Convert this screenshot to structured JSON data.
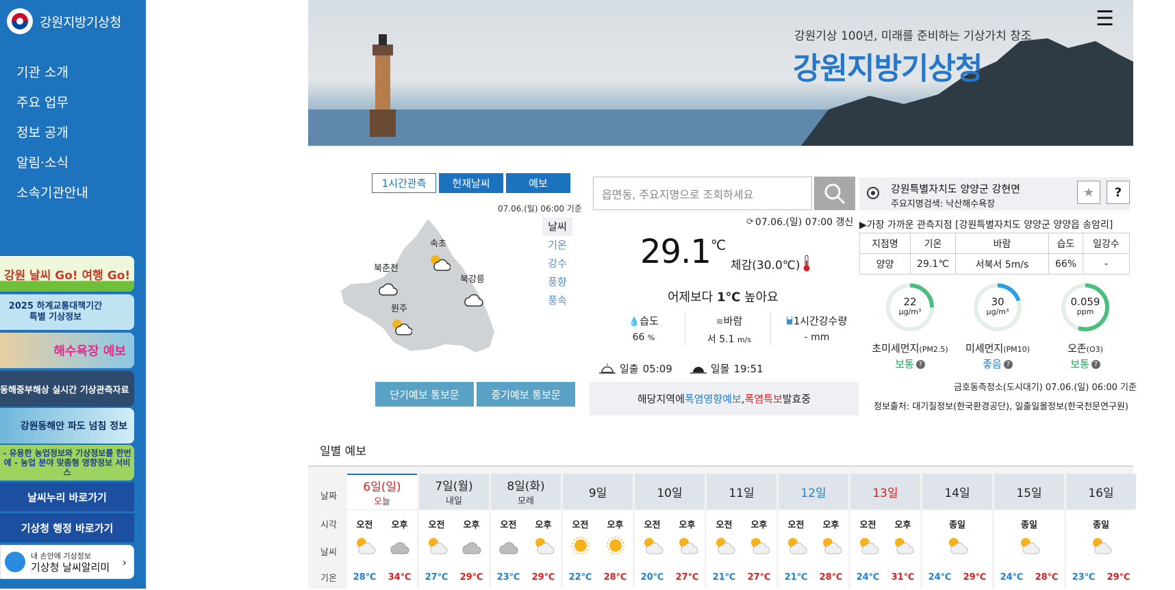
{
  "sidebar": {
    "logo_text": "강원지방기상청",
    "nav": [
      "기관 소개",
      "주요 업무",
      "정보 공개",
      "알림·소식",
      "소속기관안내"
    ],
    "banners": [
      "강원 날씨 Go! 여행 Go!",
      "2025 하계교통대책기간 특별 기상정보",
      "해수욕장 예보",
      "동해중부해상 실시간 기상관측자료",
      "강원동해안 파도 넘침 정보",
      "- 유용한 농업정보와 기상정보를 한번에 - 농업 분야 맞춤형 영향정보 서비스"
    ],
    "links": [
      "날씨누리 바로가기",
      "기상청 행정 바로가기"
    ],
    "app_banner": {
      "line1": "내 손안에 기상정보",
      "line2": "기상청 날씨알리미"
    }
  },
  "hero": {
    "subtitle": "강원기상 100년, 미래를 준비하는 기상가치 창조",
    "title": "강원지방기상청"
  },
  "map_panel": {
    "tabs": [
      "1시간관측",
      "현재날씨",
      "예보"
    ],
    "timestamp": "07.06.(일) 06:00 기준",
    "side_items": [
      "날씨",
      "기온",
      "강수",
      "풍향",
      "풍속"
    ],
    "cities": [
      "속초",
      "북춘천",
      "북강릉",
      "원주"
    ],
    "buttons": [
      "단기예보 통보문",
      "중기예보 통보문"
    ]
  },
  "current": {
    "search_placeholder": "읍면동, 주요지명으로 조회하세요",
    "updated": "07.06.(일) 07:00 갱신",
    "temp": "29.1",
    "temp_unit": "℃",
    "feels": "체감(30.0℃)",
    "compare_pre": "어제보다 ",
    "compare_val": "1℃",
    "compare_post": " 높아요",
    "humidity_label": "습도",
    "humidity_val": "66",
    "humidity_unit": "%",
    "wind_label": "바람",
    "wind_val": "서 5.1",
    "wind_unit": "m/s",
    "rain_label": "1시간강수량",
    "rain_val": "- mm",
    "sunrise_label": "일출",
    "sunrise": "05:09",
    "sunset_label": "일몰",
    "sunset": "19:51",
    "alert_pre": "해당지역에 ",
    "alert_a": "폭염영향예보",
    "alert_sep": ",",
    "alert_b1": "폭염 ",
    "alert_b2": "특보",
    "alert_post": " 발효중"
  },
  "location": {
    "name": "강원특별자치도 양양군 강현면",
    "sub": "주요지명검색: 낙산해수욕장",
    "nearest": "▶가장 가까운 관측지점 [강원특별자치도 양양군 양양읍 송암리]",
    "obs_headers": [
      "지점명",
      "기온",
      "바람",
      "습도",
      "일강수"
    ],
    "obs_values": [
      "양양",
      "29.1℃",
      "서북서 5m/s",
      "66%",
      "-"
    ]
  },
  "air": {
    "items": [
      {
        "value": "22",
        "unit": "μg/m³",
        "label": "초미세먼지",
        "code": "(PM2.5)",
        "grade": "보통",
        "fraction": 0.25,
        "color": "#4cbf7c"
      },
      {
        "value": "30",
        "unit": "μg/m³",
        "label": "미세먼지",
        "code": "(PM10)",
        "grade": "좋음",
        "fraction": 0.2,
        "color": "#2ba1e0"
      },
      {
        "value": "0.059",
        "unit": "ppm",
        "label": "오존",
        "code": "(O3)",
        "grade": "보통",
        "fraction": 0.55,
        "color": "#4cbf7c"
      }
    ],
    "station": "금호동측정소(도시대기) 07.06.(일) 06:00 기준",
    "source": "정보출처: 대기질정보(한국환경공단), 일출일몰정보(한국천문연구원)"
  },
  "daily": {
    "title": "일별 예보",
    "row_labels": [
      "날짜",
      "시각",
      "날씨",
      "기온"
    ],
    "days": [
      {
        "date": "6일(일)",
        "sub": "오늘",
        "color": "#d9201e",
        "half": true,
        "wx": [
          "partly",
          "cloudy"
        ],
        "low": "28℃",
        "high": "34℃"
      },
      {
        "date": "7일(월)",
        "sub": "내일",
        "color": "#222",
        "half": true,
        "wx": [
          "partly",
          "cloudy"
        ],
        "low": "27℃",
        "high": "29℃"
      },
      {
        "date": "8일(화)",
        "sub": "모레",
        "color": "#222",
        "half": true,
        "wx": [
          "cloudy",
          "partly"
        ],
        "low": "23℃",
        "high": "29℃"
      },
      {
        "date": "9일",
        "sub": "",
        "color": "#222",
        "half": true,
        "wx": [
          "sunny",
          "sunny"
        ],
        "low": "22℃",
        "high": "28℃"
      },
      {
        "date": "10일",
        "sub": "",
        "color": "#222",
        "half": true,
        "wx": [
          "partly",
          "partly"
        ],
        "low": "20℃",
        "high": "27℃"
      },
      {
        "date": "11일",
        "sub": "",
        "color": "#222",
        "half": true,
        "wx": [
          "partly",
          "partly"
        ],
        "low": "21℃",
        "high": "27℃"
      },
      {
        "date": "12일",
        "sub": "",
        "color": "#1d7fd6",
        "half": true,
        "wx": [
          "partly",
          "partly"
        ],
        "low": "21℃",
        "high": "28℃"
      },
      {
        "date": "13일",
        "sub": "",
        "color": "#d9201e",
        "half": true,
        "wx": [
          "partly",
          "partly"
        ],
        "low": "24℃",
        "high": "31℃"
      },
      {
        "date": "14일",
        "sub": "",
        "color": "#222",
        "half": false,
        "wx": [
          "partly"
        ],
        "low": "24℃",
        "high": "29℃"
      },
      {
        "date": "15일",
        "sub": "",
        "color": "#222",
        "half": false,
        "wx": [
          "partly"
        ],
        "low": "24℃",
        "high": "28℃"
      },
      {
        "date": "16일",
        "sub": "",
        "color": "#222",
        "half": false,
        "wx": [
          "partly"
        ],
        "low": "23℃",
        "high": "29℃"
      }
    ],
    "am": "오전",
    "pm": "오후",
    "allday": "종일"
  }
}
